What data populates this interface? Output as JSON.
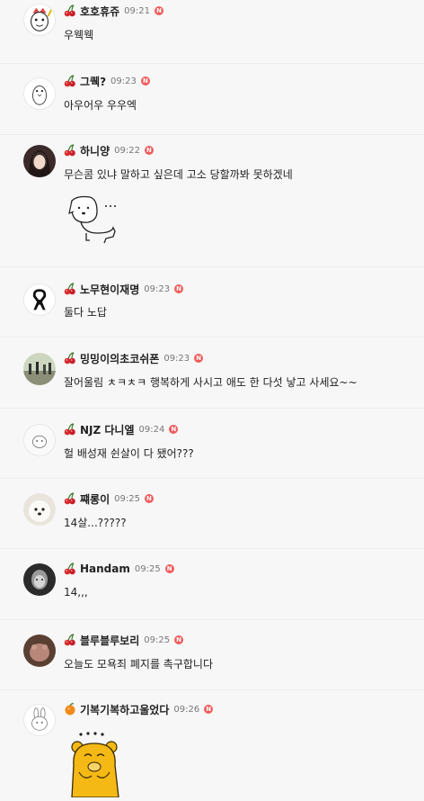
{
  "new_badge": "N",
  "comments": [
    {
      "nickname": "호호휴쥬",
      "time": "09:21",
      "text": "우웩웩",
      "badge": "cherry-icon"
    },
    {
      "nickname": "그퀙?",
      "time": "09:23",
      "text": "아우어우 우우엑",
      "badge": "cherry-icon"
    },
    {
      "nickname": "하니양",
      "time": "09:22",
      "text": "무슨콤 있냐 말하고 싶은데 고소 당할까봐 못하겠네",
      "badge": "cherry-icon",
      "sticker": "puppy-sticker"
    },
    {
      "nickname": "노무현이재명",
      "time": "09:23",
      "text": "둘다 노답",
      "badge": "cherry-icon"
    },
    {
      "nickname": "밍밍이의초코쉬폰",
      "time": "09:23",
      "text": "잘어울림 ㅊㅋㅊㅋ 행복하게 사시고 애도 한 다섯 낳고 사세요~~",
      "badge": "cherry-icon"
    },
    {
      "nickname": "NJZ 다니엘",
      "time": "09:24",
      "text": "헐 배성재 쉰살이 다 됐어???",
      "badge": "cherry-icon"
    },
    {
      "nickname": "쨰롱이",
      "time": "09:25",
      "text": "14살...?????",
      "badge": "cherry-icon"
    },
    {
      "nickname": "Handam",
      "time": "09:25",
      "text": "14,,,",
      "badge": "cherry-icon"
    },
    {
      "nickname": "블루블루보리",
      "time": "09:25",
      "text": "오늘도 모욕죄 폐지를 촉구합니다",
      "badge": "cherry-icon"
    },
    {
      "nickname": "기복기복하고울었다",
      "time": "09:26",
      "text": "",
      "badge": "orange-icon",
      "sticker": "bear-sticker"
    }
  ],
  "colors": {
    "new_badge": "#ef5c5c",
    "background": "#f7f7f7",
    "time_text": "#777777"
  }
}
